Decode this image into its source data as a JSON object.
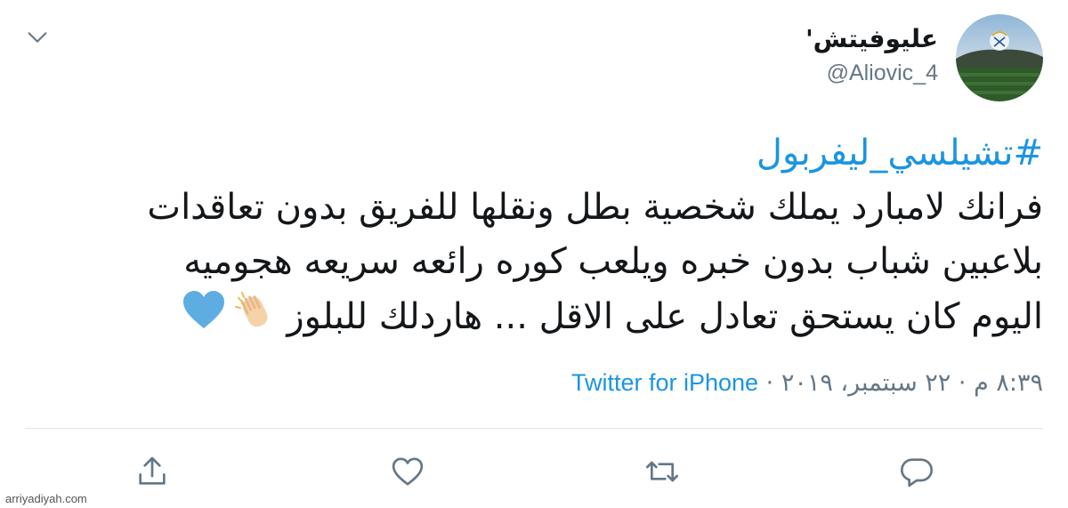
{
  "user": {
    "display_name": "عليوفيتش'",
    "handle": "@Aliovic_4",
    "avatar_icon": "real-madrid-stadium-avatar"
  },
  "tweet": {
    "hashtag": "#تشيلسي_ليفربول",
    "lines": [
      "فرانك لامبارد يملك شخصية بطل ونقلها للفريق بدون تعاقدات",
      "بلاعبين شباب بدون خبره ويلعب كوره رائعه سريعه هجوميه",
      "اليوم كان يستحق تعادل على الاقل ... هاردلك للبلوز"
    ],
    "emojis": [
      "clapping-hands-icon",
      "blue-heart-icon"
    ]
  },
  "meta": {
    "time": "٨:٣٩ م",
    "separator": "·",
    "date": "٢٢ سبتمبر، ٢٠١٩",
    "source": "Twitter for iPhone"
  },
  "actions": [
    "reply-icon",
    "retweet-icon",
    "like-icon",
    "share-icon"
  ],
  "watermark": "arriyadiyah.com",
  "colors": {
    "link": "#1b95e0",
    "text": "#14171a",
    "muted": "#657786",
    "icon": "#657786",
    "divider": "#e1e8ed",
    "heart": "#5dade2"
  }
}
